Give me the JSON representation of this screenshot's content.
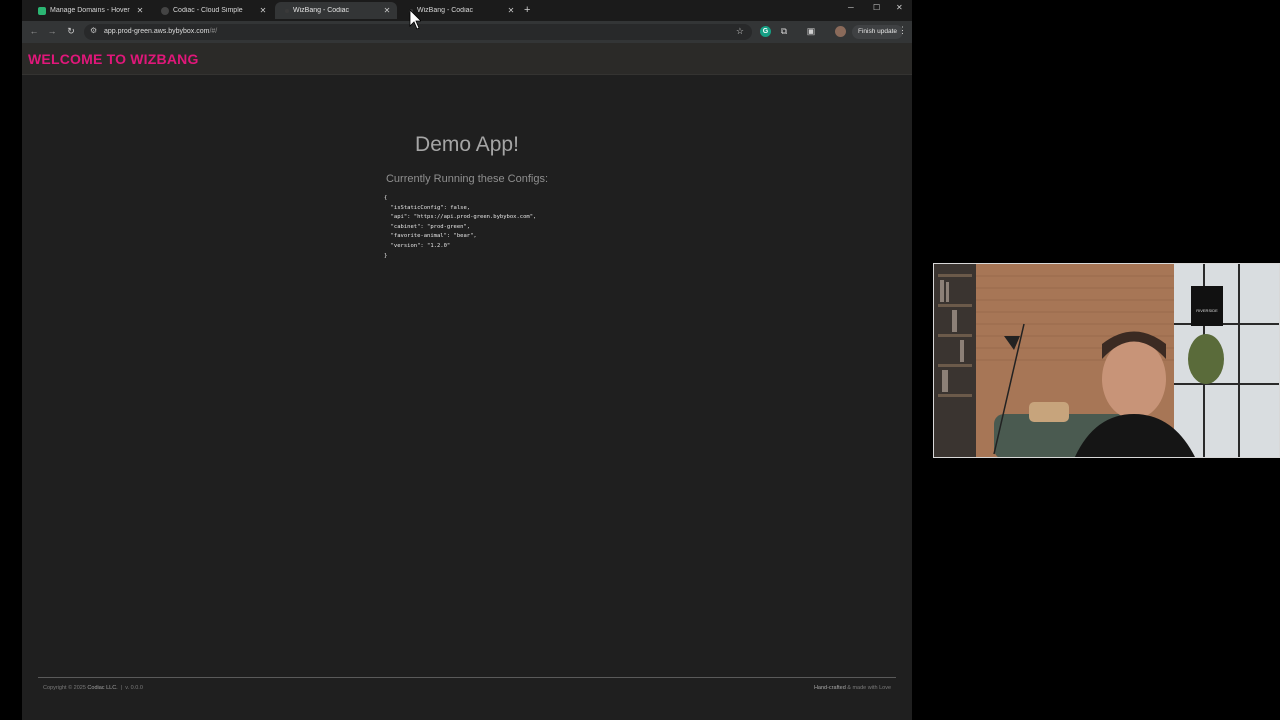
{
  "tabs": [
    {
      "title": "Manage Domains - Hover",
      "favicon_color": "#2bb673",
      "active": false
    },
    {
      "title": "Codiac - Cloud Simple",
      "favicon_color": "#444444",
      "active": false
    },
    {
      "title": "WizBang - Codiac",
      "favicon_color": "#3a3a3a",
      "active": true
    },
    {
      "title": "WizBang - Codiac",
      "favicon_color": "#3a3a3a",
      "active": false
    }
  ],
  "toolbar": {
    "url_main": "app.prod-green.aws.bybybox.com",
    "url_tail": "/#/",
    "extension_letter": "G",
    "finish_update_label": "Finish update"
  },
  "app": {
    "brand": "WELCOME TO WIZBANG",
    "brand_color": "#e0177a",
    "heading": "Demo App!",
    "subheading": "Currently Running these Configs:",
    "config_lines": [
      "{",
      "  \"isStaticConfig\": false,",
      "  \"api\": \"https://api.prod-green.bybybox.com\",",
      "  \"cabinet\": \"prod-green\",",
      "  \"favorite-animal\": \"bear\",",
      "  \"version\": \"1.2.0\"",
      "}"
    ]
  },
  "footer": {
    "copyright_prefix": "Copyright © 2025",
    "company": "Codiac LLC.",
    "separator": "|",
    "version": "v. 0.0.0",
    "handcrafted_prefix": "Hand-crafted",
    "handcrafted_suffix": "& made with Love"
  },
  "webcam": {
    "sign_text": "RIVERSIDE"
  }
}
